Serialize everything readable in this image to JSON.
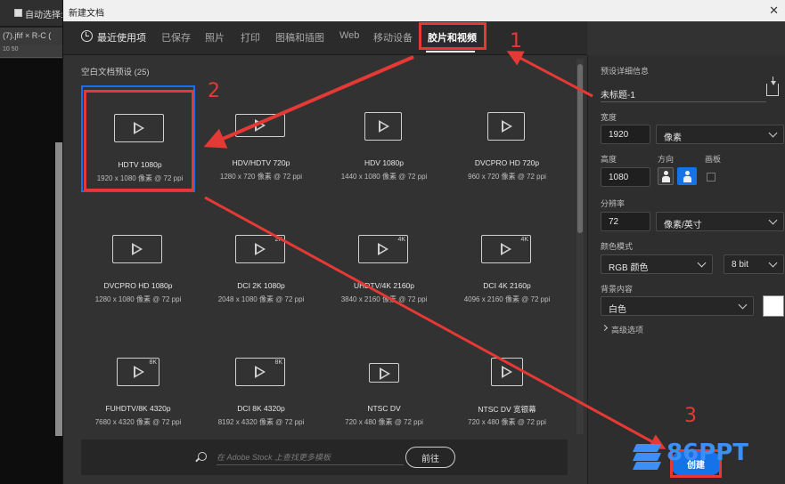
{
  "background": {
    "toolbar_option": "自动选择:",
    "tab_label": "(7).jfif × R-C (",
    "ruler_ticks": "10   50"
  },
  "dialog": {
    "title": "新建文档",
    "close": "✕",
    "tabs": [
      {
        "label": "最近使用项"
      },
      {
        "label": "已保存"
      },
      {
        "label": "照片"
      },
      {
        "label": "打印"
      },
      {
        "label": "图稿和插图"
      },
      {
        "label": "Web"
      },
      {
        "label": "移动设备"
      },
      {
        "label": "胶片和视频",
        "active": true
      }
    ],
    "section_title": "空白文档预设 (25)",
    "presets": [
      {
        "name": "HDTV 1080p",
        "size": "1920 x 1080 像素 @ 72 ppi",
        "badge": "",
        "selected": true
      },
      {
        "name": "HDV/HDTV 720p",
        "size": "1280 x 720 像素 @ 72 ppi",
        "badge": ""
      },
      {
        "name": "HDV 1080p",
        "size": "1440 x 1080 像素 @ 72 ppi",
        "badge": ""
      },
      {
        "name": "DVCPRO HD 720p",
        "size": "960 x 720 像素 @ 72 ppi",
        "badge": ""
      },
      {
        "name": "DVCPRO HD 1080p",
        "size": "1280 x 1080 像素 @ 72 ppi",
        "badge": ""
      },
      {
        "name": "DCI 2K 1080p",
        "size": "2048 x 1080 像素 @ 72 ppi",
        "badge": "2K"
      },
      {
        "name": "UHDTV/4K 2160p",
        "size": "3840 x 2160 像素 @ 72 ppi",
        "badge": "4K"
      },
      {
        "name": "DCI 4K 2160p",
        "size": "4096 x 2160 像素 @ 72 ppi",
        "badge": "4K"
      },
      {
        "name": "FUHDTV/8K 4320p",
        "size": "7680 x 4320 像素 @ 72 ppi",
        "badge": "8K"
      },
      {
        "name": "DCI 8K 4320p",
        "size": "8192 x 4320 像素 @ 72 ppi",
        "badge": "8K"
      },
      {
        "name": "NTSC DV",
        "size": "720 x 480 像素 @ 72 ppi",
        "badge": ""
      },
      {
        "name": "NTSC DV 宽银幕",
        "size": "720 x 480 像素 @ 72 ppi",
        "badge": ""
      }
    ],
    "search": {
      "placeholder": "在 Adobe Stock 上查找更多模板",
      "go_label": "前往"
    }
  },
  "details": {
    "heading": "预设详细信息",
    "doc_name": "未标题-1",
    "width_label": "宽度",
    "width_value": "1920",
    "width_unit": "像素",
    "height_label": "高度",
    "height_value": "1080",
    "orientation_label": "方向",
    "artboard_label": "画板",
    "resolution_label": "分辨率",
    "resolution_value": "72",
    "resolution_unit": "像素/英寸",
    "color_mode_label": "颜色模式",
    "color_mode": "RGB 颜色",
    "bit_depth": "8 bit",
    "bg_label": "背景内容",
    "bg_value": "白色",
    "bg_color": "#ffffff",
    "advanced": "高级选项",
    "create_label": "创建"
  },
  "annotations": {
    "n1": "1",
    "n2": "2",
    "n3": "3",
    "color": "#e53935"
  },
  "watermark": {
    "text": "86PPT"
  },
  "colors": {
    "accent": "#1473e6",
    "dialog_bg": "#323232"
  }
}
